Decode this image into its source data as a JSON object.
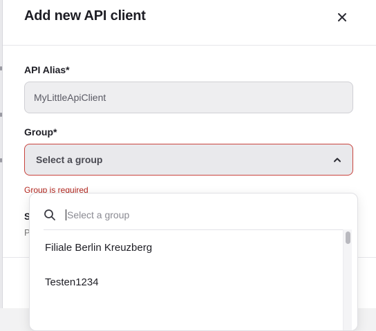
{
  "modal": {
    "title": "Add new API client",
    "close_icon": "close-icon"
  },
  "form": {
    "alias": {
      "label": "API Alias*",
      "value": "MyLittleApiClient"
    },
    "group": {
      "label": "Group*",
      "placeholder": "Select a group",
      "error": "Group is required",
      "chevron_icon": "chevron-up-icon"
    },
    "obscured_field": {
      "label_fragment": "S",
      "sub_fragment": "P"
    }
  },
  "dropdown": {
    "search_icon": "search-icon",
    "search_placeholder": "Select a group",
    "options": [
      {
        "label": "Filiale Berlin Kreuzberg"
      },
      {
        "label": "Testen1234"
      }
    ]
  },
  "colors": {
    "error": "#c8423c",
    "error_text": "#b3261e",
    "input_bg": "#eeeef0",
    "select_bg": "#e9e9ec"
  }
}
